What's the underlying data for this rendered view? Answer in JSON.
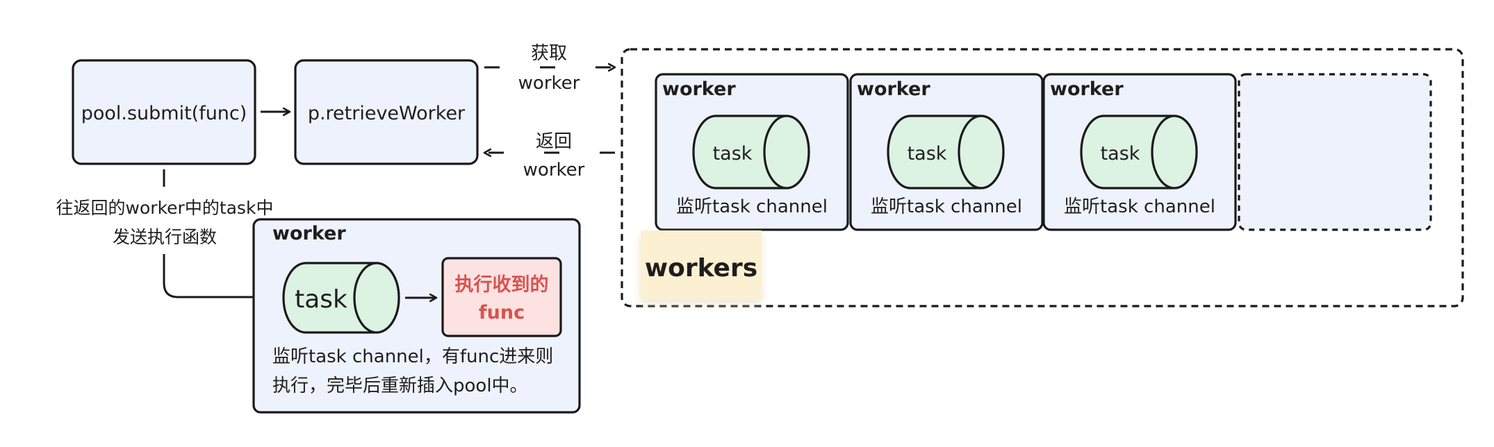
{
  "nodes": {
    "submit": "pool.submit(func)",
    "retrieve": "p.retrieveWorker",
    "worker_label": "worker",
    "task_label": "task",
    "listen_label": "监听task channel",
    "workers_tag": "workers",
    "detail_exec": [
      "执行收到的",
      "func"
    ],
    "detail_desc": [
      "监听task channel，有func进来则",
      "执行，完毕后重新插入pool中。"
    ]
  },
  "edges": {
    "get_worker": [
      "获取",
      "worker"
    ],
    "return_worker": [
      "返回",
      "worker"
    ],
    "send_func": [
      "往返回的worker中的task中",
      "发送执行函数"
    ]
  },
  "colors": {
    "box_fill": "#eef2fc",
    "stroke": "#1a1a1a",
    "task_fill": "#dcf2e2",
    "exec_fill": "#fde2e2",
    "exec_text": "#d9534f",
    "tag_fill": "#fcf0d2"
  }
}
